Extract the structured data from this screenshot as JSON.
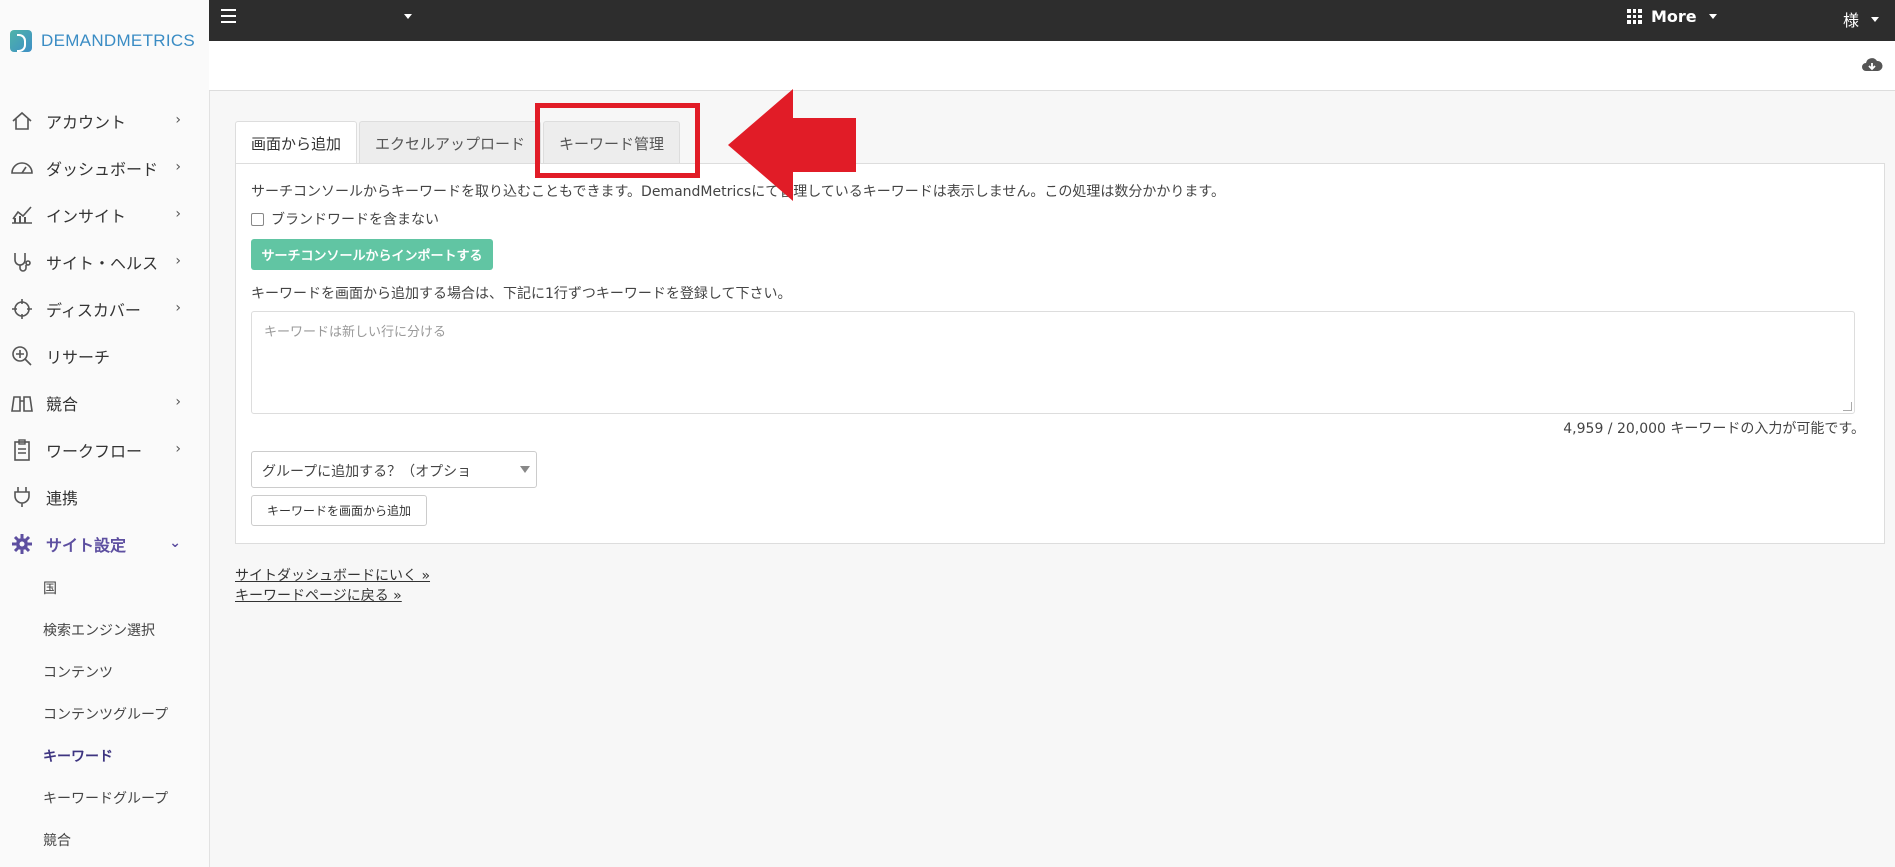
{
  "brand": {
    "name": "DEMANDMETRICS"
  },
  "sidebar": {
    "items": [
      {
        "label": "アカウント",
        "icon": "home-icon"
      },
      {
        "label": "ダッシュボード",
        "icon": "dashboard-icon"
      },
      {
        "label": "インサイト",
        "icon": "chart-icon"
      },
      {
        "label": "サイト・ヘルス",
        "icon": "stethoscope-icon"
      },
      {
        "label": "ディスカバー",
        "icon": "crosshair-icon"
      },
      {
        "label": "リサーチ",
        "icon": "search-plus-icon"
      },
      {
        "label": "競合",
        "icon": "binoculars-icon"
      },
      {
        "label": "ワークフロー",
        "icon": "clipboard-icon"
      },
      {
        "label": "連携",
        "icon": "plug-icon"
      },
      {
        "label": "サイト設定",
        "icon": "gear-icon"
      }
    ],
    "subitems": [
      "国",
      "検索エンジン選択",
      "コンテンツ",
      "コンテンツグループ",
      "キーワード",
      "キーワードグループ",
      "競合"
    ]
  },
  "topbar": {
    "more_label": "More",
    "user_label": "様"
  },
  "tabs": [
    {
      "label": "画面から追加"
    },
    {
      "label": "エクセルアップロード"
    },
    {
      "label": "キーワード管理"
    }
  ],
  "panel": {
    "info_text": "サーチコンソールからキーワードを取り込むこともできます。DemandMetricsにて管理しているキーワードは表示しません。この処理は数分かかります。",
    "brand_checkbox_label": "ブランドワードを含まない",
    "import_button": "サーチコンソールからインポートする",
    "instruction": "キーワードを画面から追加する場合は、下記に1行ずつキーワードを登録して下さい。",
    "textarea_placeholder": "キーワードは新しい行に分ける",
    "counter": "4,959 / 20,000 キーワードの入力が可能です。",
    "group_select": "グループに追加する？（オプショ",
    "add_button": "キーワードを画面から追加"
  },
  "links": {
    "dashboard": "サイトダッシュボードにいく »",
    "back": "キーワードページに戻る »"
  },
  "colors": {
    "accent": "#5d4fa0",
    "green": "#61c5a3",
    "annotation_red": "#e11c27",
    "topbar": "#2d2d2d"
  }
}
